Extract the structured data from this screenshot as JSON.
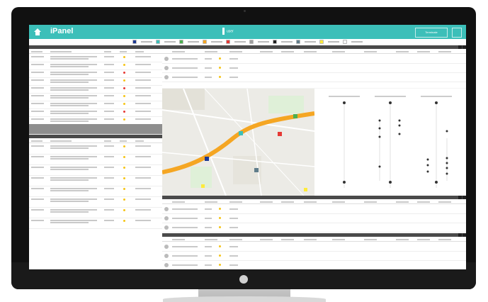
{
  "app": {
    "title": "iPanel",
    "user": "user"
  },
  "topbar": {
    "logout_label": "Terminate"
  },
  "legend_colors": [
    "#1f3a93",
    "#3cbfb9",
    "#4caf50",
    "#f5a623",
    "#e53935",
    "#9e9e9e",
    "#212121",
    "#607d8b",
    "#ffeb3b",
    "#f5f5f5"
  ],
  "left_top_table": {
    "rows": 9,
    "status_colors": [
      "#f5c518",
      "#f5c518",
      "#e53935",
      "#f5c518",
      "#e53935",
      "#f5c518",
      "#f5c518",
      "#e53935",
      "#f5c518"
    ]
  },
  "left_bottom_table": {
    "rows": 8,
    "status_colors": [
      "#f5c518",
      "#f5c518",
      "#f5c518",
      "#f5c518",
      "#f5c518",
      "#f5c518",
      "#f5c518",
      "#f5c518"
    ]
  },
  "right_top_table": {
    "rows": 3,
    "status_colors": [
      "#f5c518",
      "#f5c518",
      "#f5c518"
    ]
  },
  "right_mid_table": {
    "rows": 3,
    "status_colors": [
      "#f5c518",
      "#f5c518",
      "#f5c518"
    ]
  },
  "right_bottom_table": {
    "rows": 3,
    "status_colors": [
      "#f5c518",
      "#f5c518",
      "#f5c518"
    ]
  }
}
